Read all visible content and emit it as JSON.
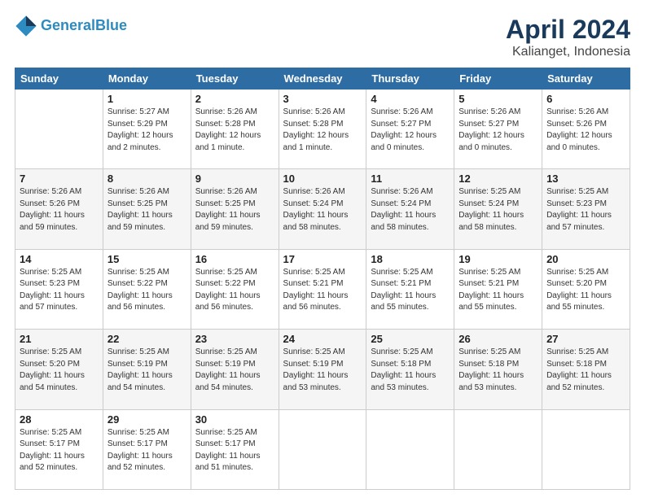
{
  "logo": {
    "line1": "General",
    "line2": "Blue"
  },
  "title": "April 2024",
  "subtitle": "Kalianget, Indonesia",
  "days_header": [
    "Sunday",
    "Monday",
    "Tuesday",
    "Wednesday",
    "Thursday",
    "Friday",
    "Saturday"
  ],
  "weeks": [
    [
      {
        "num": "",
        "info": ""
      },
      {
        "num": "1",
        "info": "Sunrise: 5:27 AM\nSunset: 5:29 PM\nDaylight: 12 hours\nand 2 minutes."
      },
      {
        "num": "2",
        "info": "Sunrise: 5:26 AM\nSunset: 5:28 PM\nDaylight: 12 hours\nand 1 minute."
      },
      {
        "num": "3",
        "info": "Sunrise: 5:26 AM\nSunset: 5:28 PM\nDaylight: 12 hours\nand 1 minute."
      },
      {
        "num": "4",
        "info": "Sunrise: 5:26 AM\nSunset: 5:27 PM\nDaylight: 12 hours\nand 0 minutes."
      },
      {
        "num": "5",
        "info": "Sunrise: 5:26 AM\nSunset: 5:27 PM\nDaylight: 12 hours\nand 0 minutes."
      },
      {
        "num": "6",
        "info": "Sunrise: 5:26 AM\nSunset: 5:26 PM\nDaylight: 12 hours\nand 0 minutes."
      }
    ],
    [
      {
        "num": "7",
        "info": "Sunrise: 5:26 AM\nSunset: 5:26 PM\nDaylight: 11 hours\nand 59 minutes."
      },
      {
        "num": "8",
        "info": "Sunrise: 5:26 AM\nSunset: 5:25 PM\nDaylight: 11 hours\nand 59 minutes."
      },
      {
        "num": "9",
        "info": "Sunrise: 5:26 AM\nSunset: 5:25 PM\nDaylight: 11 hours\nand 59 minutes."
      },
      {
        "num": "10",
        "info": "Sunrise: 5:26 AM\nSunset: 5:24 PM\nDaylight: 11 hours\nand 58 minutes."
      },
      {
        "num": "11",
        "info": "Sunrise: 5:26 AM\nSunset: 5:24 PM\nDaylight: 11 hours\nand 58 minutes."
      },
      {
        "num": "12",
        "info": "Sunrise: 5:25 AM\nSunset: 5:24 PM\nDaylight: 11 hours\nand 58 minutes."
      },
      {
        "num": "13",
        "info": "Sunrise: 5:25 AM\nSunset: 5:23 PM\nDaylight: 11 hours\nand 57 minutes."
      }
    ],
    [
      {
        "num": "14",
        "info": "Sunrise: 5:25 AM\nSunset: 5:23 PM\nDaylight: 11 hours\nand 57 minutes."
      },
      {
        "num": "15",
        "info": "Sunrise: 5:25 AM\nSunset: 5:22 PM\nDaylight: 11 hours\nand 56 minutes."
      },
      {
        "num": "16",
        "info": "Sunrise: 5:25 AM\nSunset: 5:22 PM\nDaylight: 11 hours\nand 56 minutes."
      },
      {
        "num": "17",
        "info": "Sunrise: 5:25 AM\nSunset: 5:21 PM\nDaylight: 11 hours\nand 56 minutes."
      },
      {
        "num": "18",
        "info": "Sunrise: 5:25 AM\nSunset: 5:21 PM\nDaylight: 11 hours\nand 55 minutes."
      },
      {
        "num": "19",
        "info": "Sunrise: 5:25 AM\nSunset: 5:21 PM\nDaylight: 11 hours\nand 55 minutes."
      },
      {
        "num": "20",
        "info": "Sunrise: 5:25 AM\nSunset: 5:20 PM\nDaylight: 11 hours\nand 55 minutes."
      }
    ],
    [
      {
        "num": "21",
        "info": "Sunrise: 5:25 AM\nSunset: 5:20 PM\nDaylight: 11 hours\nand 54 minutes."
      },
      {
        "num": "22",
        "info": "Sunrise: 5:25 AM\nSunset: 5:19 PM\nDaylight: 11 hours\nand 54 minutes."
      },
      {
        "num": "23",
        "info": "Sunrise: 5:25 AM\nSunset: 5:19 PM\nDaylight: 11 hours\nand 54 minutes."
      },
      {
        "num": "24",
        "info": "Sunrise: 5:25 AM\nSunset: 5:19 PM\nDaylight: 11 hours\nand 53 minutes."
      },
      {
        "num": "25",
        "info": "Sunrise: 5:25 AM\nSunset: 5:18 PM\nDaylight: 11 hours\nand 53 minutes."
      },
      {
        "num": "26",
        "info": "Sunrise: 5:25 AM\nSunset: 5:18 PM\nDaylight: 11 hours\nand 53 minutes."
      },
      {
        "num": "27",
        "info": "Sunrise: 5:25 AM\nSunset: 5:18 PM\nDaylight: 11 hours\nand 52 minutes."
      }
    ],
    [
      {
        "num": "28",
        "info": "Sunrise: 5:25 AM\nSunset: 5:17 PM\nDaylight: 11 hours\nand 52 minutes."
      },
      {
        "num": "29",
        "info": "Sunrise: 5:25 AM\nSunset: 5:17 PM\nDaylight: 11 hours\nand 52 minutes."
      },
      {
        "num": "30",
        "info": "Sunrise: 5:25 AM\nSunset: 5:17 PM\nDaylight: 11 hours\nand 51 minutes."
      },
      {
        "num": "",
        "info": ""
      },
      {
        "num": "",
        "info": ""
      },
      {
        "num": "",
        "info": ""
      },
      {
        "num": "",
        "info": ""
      }
    ]
  ]
}
